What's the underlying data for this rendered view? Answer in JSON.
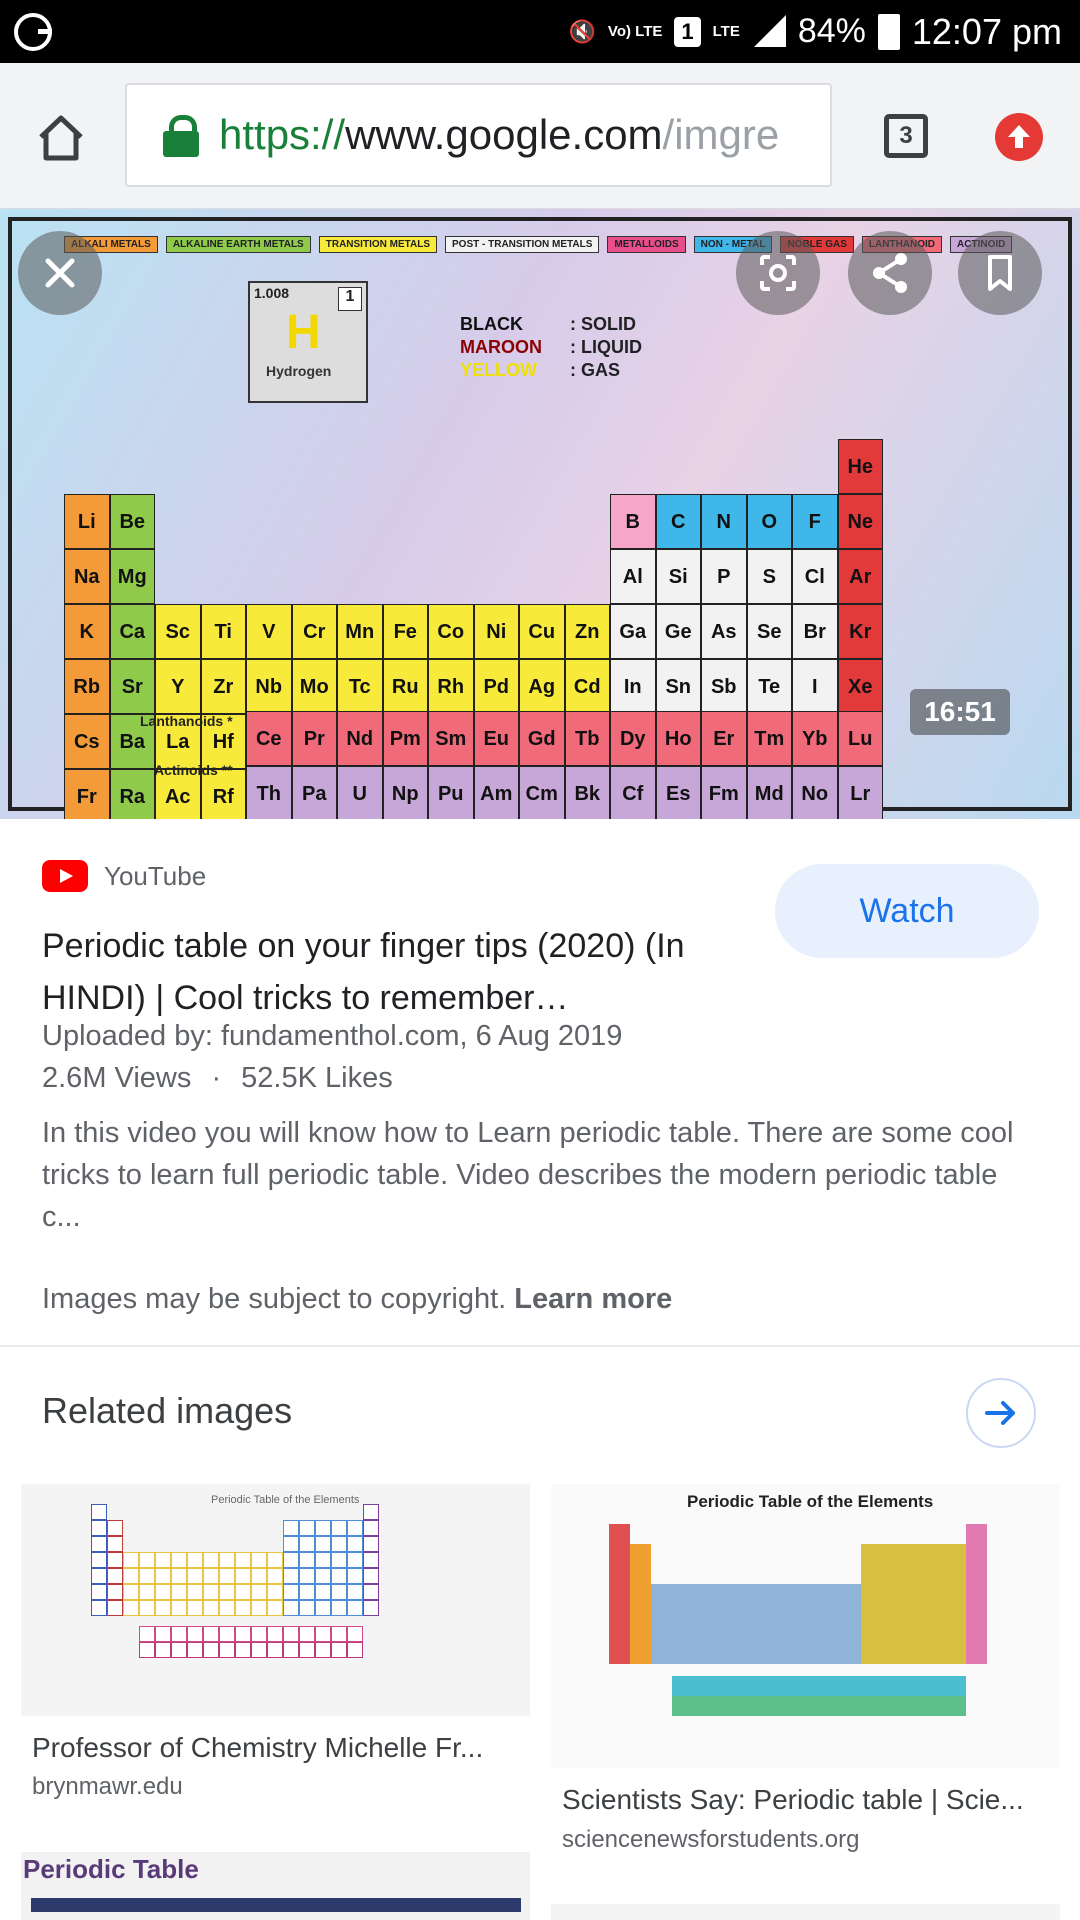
{
  "status_bar": {
    "network": "Vo) LTE",
    "sim": "1",
    "lte": "LTE",
    "battery": "84%",
    "time": "12:07 pm"
  },
  "browser": {
    "url_scheme": "https://",
    "url_host": "www.google.com",
    "url_path": "/imgre",
    "tab_count": "3"
  },
  "preview": {
    "duration": "16:51",
    "table": {
      "legend": [
        "ALKALI METALS",
        "ALKALINE EARTH METALS",
        "TRANSITION METALS",
        "POST - TRANSITION METALS",
        "METALLOIDS",
        "NON - METAL",
        "NOBLE GAS",
        "LANTHANOID",
        "ACTINOID"
      ],
      "key_weight": "1.008",
      "key_number": "1",
      "key_symbol": "H",
      "key_name": "Hydrogen",
      "state_lines": [
        {
          "color": "BLACK",
          "state": "SOLID"
        },
        {
          "color": "MAROON",
          "state": "LIQUID"
        },
        {
          "color": "YELLOW",
          "state": "GAS"
        }
      ],
      "lanthanoids_label": "Lanthanoids *",
      "actinoids_label": "Actinoids **"
    }
  },
  "result": {
    "source": "YouTube",
    "watch_label": "Watch",
    "title": "Periodic table on your finger tips (2020) (In HINDI) | Cool tricks to remember…",
    "uploaded": "Uploaded by: fundamenthol.com, 6 Aug 2019",
    "views": "2.6M Views",
    "likes": "52.5K Likes",
    "stats_sep": "·",
    "description": "In this video you will know how to Learn periodic table. There are some cool tricks to learn full periodic table. Video describes the modern periodic table c...",
    "copyright_text": "Images may be subject to copyright.",
    "learn_more": "Learn more"
  },
  "related": {
    "heading": "Related images",
    "items": [
      {
        "title": "Professor of Chemistry Michelle Fr...",
        "site": "brynmawr.edu",
        "thumb_title": "Periodic Table of the Elements"
      },
      {
        "title": "Scientists Say: Periodic table | Scie...",
        "site": "sciencenewsforstudents.org",
        "thumb_title": "Periodic Table of the Elements"
      },
      {
        "thumb_title": "Periodic Table"
      }
    ]
  }
}
